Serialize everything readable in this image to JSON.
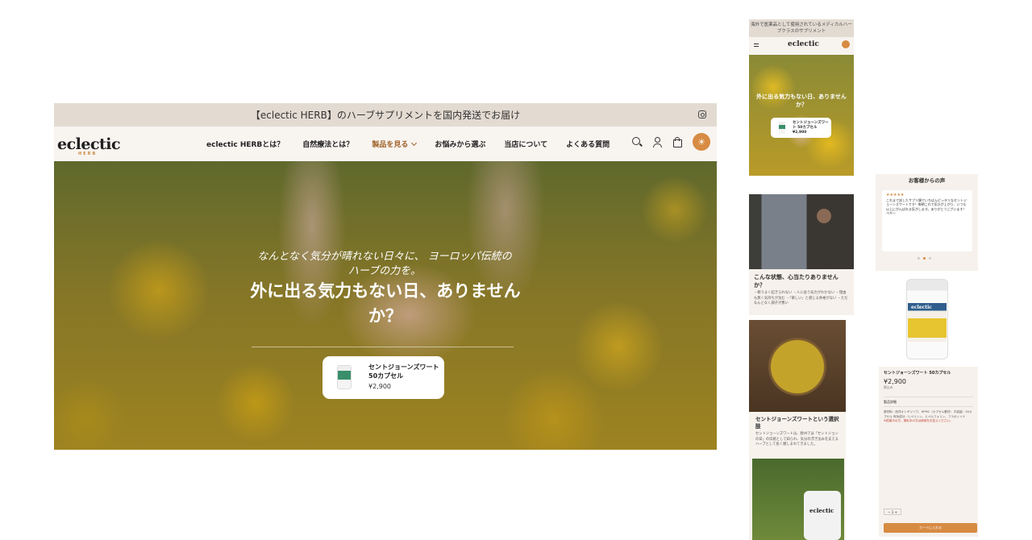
{
  "desktop": {
    "announcement": "【eclectic HERB】のハーブサプリメントを国内発送でお届け",
    "logo": "eclectic",
    "logo_sub": "HERB",
    "nav": {
      "item1": "eclectic HERBとは？",
      "item2": "自然療法とは？",
      "item3": "製品を見る",
      "item4": "お悩みから選ぶ",
      "item5": "当店について",
      "item6": "よくある質問"
    },
    "hero": {
      "subtitle": "なんとなく気分が晴れない日々に、 ヨーロッパ伝統のハーブの力を。",
      "title": "外に出る気力もない日、ありませんか？",
      "product_name": "セントジョーンズワート 50カプセル",
      "product_price": "¥2,900"
    }
  },
  "mobile_top": {
    "announcement": "海外で医薬品として使用されているメディカルハーブクラスのサプリメント",
    "logo": "eclectic",
    "hero_title": "外に出る気力もない日、ありませんか？",
    "product_name": "セントジョーンズワート 50カプセル",
    "product_price": "¥2,900"
  },
  "mobile_concern": {
    "heading": "こんな状態、心当たりありませんか？",
    "body": "・朝うまく起きられない ・人に会う気力がわかない ・理由も無く気持ちが沈む ・「楽しい」と感じる余裕がない ・ただなんとなく調子が悪い"
  },
  "mobile_choice": {
    "heading": "セントジョーンズワートという選択肢",
    "body": "セントジョーンズワートは、欧州では「セントジョンの日」の伝統として知られ、気分の浮き沈みを支えるハーブとして長く親しまれてきました。",
    "bottle_logo": "eclectic"
  },
  "mobile_reviews": {
    "heading": "お客様からの声",
    "stars": "★★★★★",
    "review": "これまで試したサプリ類でいちばんピッタリなセントジョーンズワートです！毎朝これで気分が上がり、いつも以上にがんばれる気がします。ありがとうございます！",
    "author": "ペギー"
  },
  "mobile_product": {
    "jar_logo": "eclectic",
    "name": "セントジョーンズワート 50カプセル",
    "price": "¥2,900",
    "tax": "税込み",
    "accordion_label": "製品詳細",
    "details": "原材料：西洋オトギリソウ、HPMC（カプセル基材） 内容量：50カプセル 有効成分：ヒペリシン、ヒペルフォリン、フラボノイド",
    "warning": "※妊娠中の方、授乳中の方は使用をお控えください。",
    "qty_label": "− 1 +",
    "buy_label": "カートに入れる"
  },
  "colors": {
    "accent": "#d78b43",
    "announcement_bg": "#e3dbd2",
    "nav_bg": "#f8f4f0",
    "active_nav": "#a0622a"
  }
}
